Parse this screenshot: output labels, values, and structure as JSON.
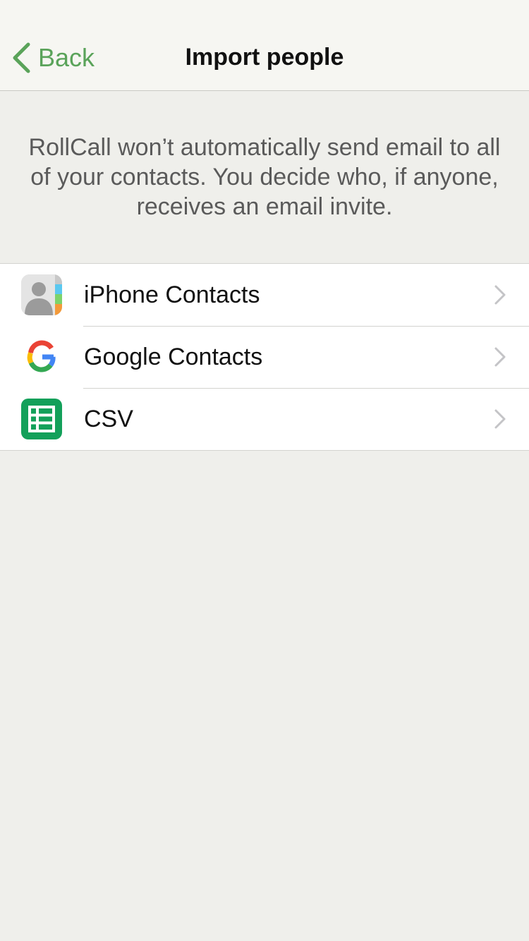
{
  "nav": {
    "back_label": "Back",
    "title": "Import people"
  },
  "notice": {
    "text": "RollCall won’t automatically send email to all of your contacts. You decide who, if anyone, receives an email invite."
  },
  "sources": [
    {
      "label": "iPhone Contacts",
      "icon": "contacts-app-icon"
    },
    {
      "label": "Google Contacts",
      "icon": "google-g-icon"
    },
    {
      "label": "CSV",
      "icon": "spreadsheet-icon"
    }
  ],
  "colors": {
    "accent": "#5aa35a",
    "background": "#efefeb",
    "navbar": "#f6f6f2",
    "csv_green": "#13a05a"
  }
}
